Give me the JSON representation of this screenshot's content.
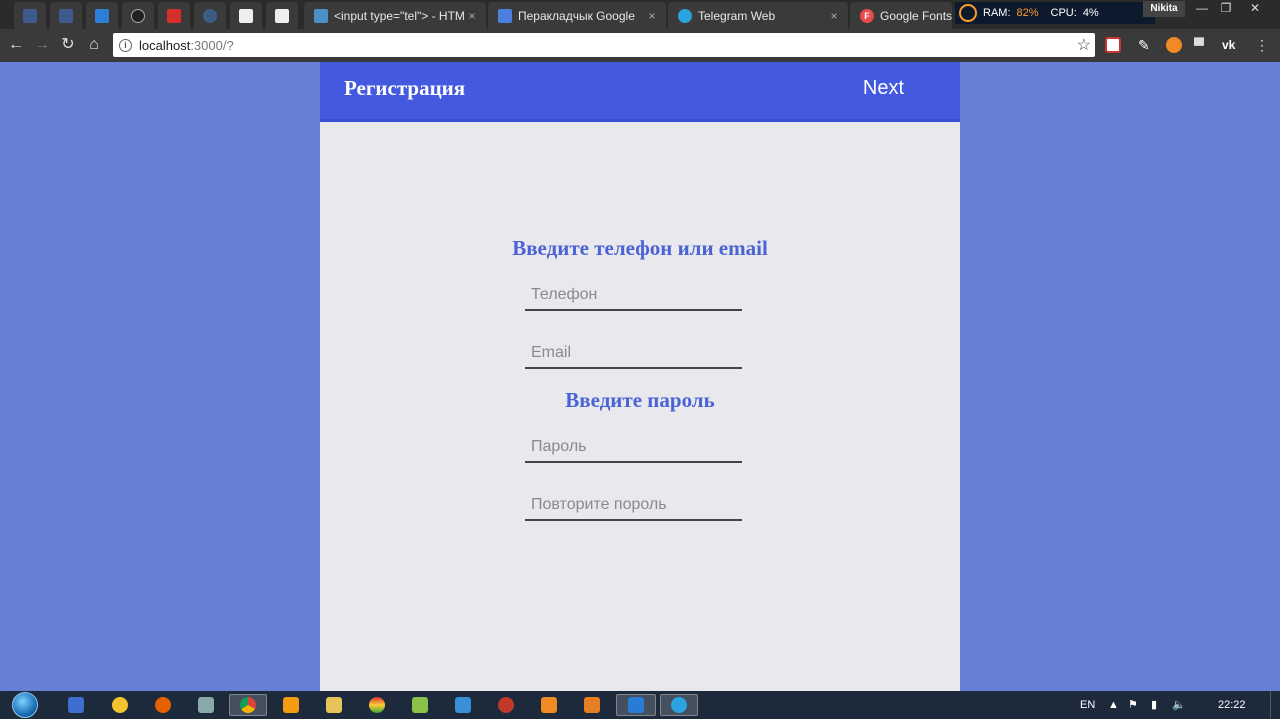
{
  "browser": {
    "tabs": [
      {
        "title": "<input type=\"tel\"> - HTML",
        "favicon": "hedgehog-icon",
        "color": "#4a90c2"
      },
      {
        "title": "Перакладчык Google",
        "favicon": "google-translate-icon",
        "color": "#4a7fe0"
      },
      {
        "title": "Telegram Web",
        "favicon": "telegram-icon",
        "color": "#2aa3e0"
      },
      {
        "title": "Google Fonts",
        "favicon": "google-fonts-icon",
        "color": "#e84a4a"
      }
    ],
    "close_glyph": "×",
    "sysmon": {
      "ram_label": "RAM:",
      "ram_value": "82%",
      "cpu_label": "CPU:",
      "cpu_value": "4%"
    },
    "profile_name": "Nikita",
    "url_host": "localhost",
    "url_rest": ":3000/?",
    "info_glyph": "i"
  },
  "app": {
    "header_title": "Регистрация",
    "next_label": "Next",
    "contact_heading": "Введите телефон или email",
    "phone_placeholder": "Телефон",
    "email_placeholder": "Email",
    "password_heading": "Введите пароль",
    "password_placeholder": "Пароль",
    "repeat_password_placeholder": "Повторите пороль"
  },
  "taskbar": {
    "language": "EN",
    "clock": "22:22"
  }
}
